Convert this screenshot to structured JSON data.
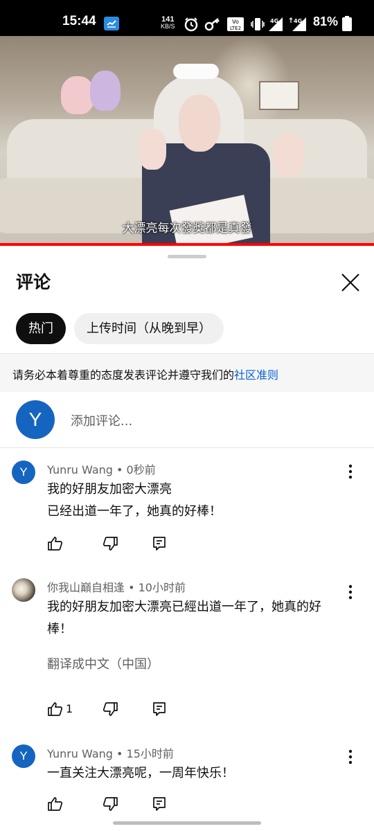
{
  "status_bar": {
    "time": "15:44",
    "net_speed_value": "141",
    "net_speed_unit": "KB/S",
    "battery_percent": "81%",
    "icons": [
      "app-notification-icon",
      "alarm-icon",
      "vpn-key-icon",
      "volte-icon",
      "vibrate-icon",
      "signal-4g-icon",
      "signal-4g-2-icon",
      "battery-icon"
    ]
  },
  "video": {
    "subtitle": "大漂亮每次發獎都是真發",
    "progress_color": "#ff0000"
  },
  "comments_sheet": {
    "title": "评论",
    "close_icon": "close-icon",
    "sort_chips": [
      {
        "label": "热门",
        "active": true
      },
      {
        "label": "上传时间（从晚到早）",
        "active": false
      }
    ],
    "guideline_text": "请务必本着尊重的态度发表评论并遵守我们的",
    "guideline_link": "社区准则",
    "add_comment": {
      "avatar_letter": "Y",
      "placeholder": "添加评论..."
    },
    "comments": [
      {
        "avatar_letter": "Y",
        "author": "Yunru Wang",
        "time": "0秒前",
        "text_lines": [
          "我的好朋友加密大漂亮",
          "已经出道一年了，她真的好棒！"
        ],
        "likes": ""
      },
      {
        "avatar_letter": "",
        "author": "你我山巔自相逢",
        "time": "10小时前",
        "text_lines": [
          "我的好朋友加密大漂亮已經出道一年了，她真的好",
          "棒！"
        ],
        "translate": "翻译成中文（中国）",
        "likes": "1"
      },
      {
        "avatar_letter": "Y",
        "author": "Yunru Wang",
        "time": "15小时前",
        "text_lines": [
          "一直关注大漂亮呢，一周年快乐！"
        ],
        "likes": ""
      }
    ]
  },
  "colors": {
    "accent_blue": "#065fd4",
    "avatar_blue": "#1565c0",
    "chip_active": "#0f0f0f",
    "chip_inactive": "#f0f0f0"
  }
}
